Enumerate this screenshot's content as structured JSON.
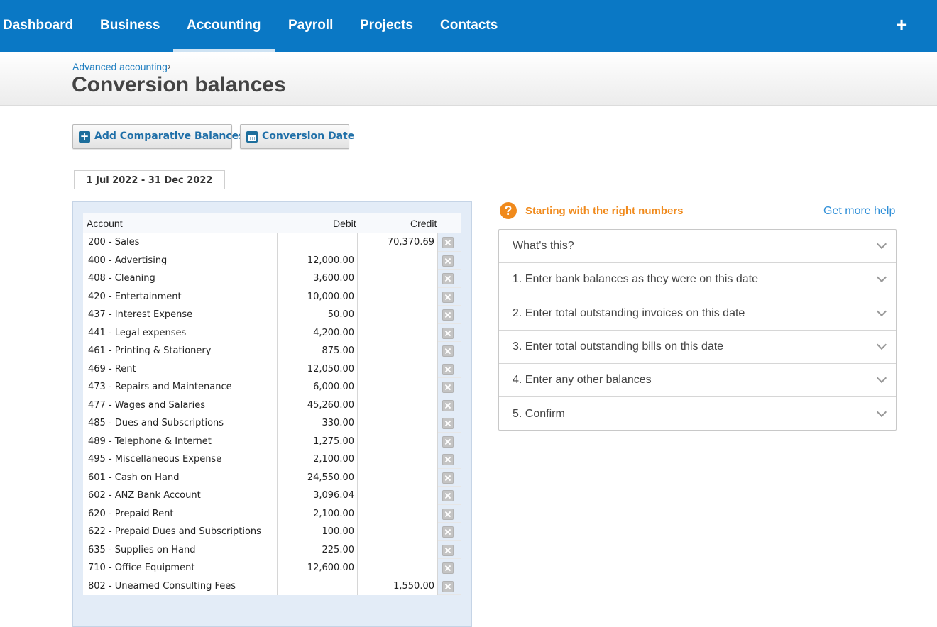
{
  "nav": {
    "items": [
      {
        "label": "Dashboard",
        "active": false
      },
      {
        "label": "Business",
        "active": false
      },
      {
        "label": "Accounting",
        "active": true
      },
      {
        "label": "Payroll",
        "active": false
      },
      {
        "label": "Projects",
        "active": false
      },
      {
        "label": "Contacts",
        "active": false
      }
    ],
    "plus_label": "+"
  },
  "header": {
    "breadcrumb": "Advanced accounting",
    "breadcrumb_separator": "›",
    "title": "Conversion balances"
  },
  "toolbar": {
    "add_comparative_label": "Add Comparative Balances",
    "conversion_date_label": "Conversion Date"
  },
  "period_tab": "1 Jul 2022 - 31 Dec 2022",
  "table": {
    "headers": {
      "account": "Account",
      "debit": "Debit",
      "credit": "Credit"
    },
    "rows": [
      {
        "account": "200 - Sales",
        "debit": "",
        "credit": "70,370.69"
      },
      {
        "account": "400 - Advertising",
        "debit": "12,000.00",
        "credit": ""
      },
      {
        "account": "408 - Cleaning",
        "debit": "3,600.00",
        "credit": ""
      },
      {
        "account": "420 - Entertainment",
        "debit": "10,000.00",
        "credit": ""
      },
      {
        "account": "437 - Interest Expense",
        "debit": "50.00",
        "credit": ""
      },
      {
        "account": "441 - Legal expenses",
        "debit": "4,200.00",
        "credit": ""
      },
      {
        "account": "461 - Printing & Stationery",
        "debit": "875.00",
        "credit": ""
      },
      {
        "account": "469 - Rent",
        "debit": "12,050.00",
        "credit": ""
      },
      {
        "account": "473 - Repairs and Maintenance",
        "debit": "6,000.00",
        "credit": ""
      },
      {
        "account": "477 - Wages and Salaries",
        "debit": "45,260.00",
        "credit": ""
      },
      {
        "account": "485 - Dues and Subscriptions",
        "debit": "330.00",
        "credit": ""
      },
      {
        "account": "489 - Telephone & Internet",
        "debit": "1,275.00",
        "credit": ""
      },
      {
        "account": "495 - Miscellaneous Expense",
        "debit": "2,100.00",
        "credit": ""
      },
      {
        "account": "601 - Cash on Hand",
        "debit": "24,550.00",
        "credit": ""
      },
      {
        "account": "602 - ANZ Bank Account",
        "debit": "3,096.04",
        "credit": ""
      },
      {
        "account": "620 - Prepaid Rent",
        "debit": "2,100.00",
        "credit": ""
      },
      {
        "account": "622 - Prepaid Dues and Subscriptions",
        "debit": "100.00",
        "credit": ""
      },
      {
        "account": "635 - Supplies on Hand",
        "debit": "225.00",
        "credit": ""
      },
      {
        "account": "710 - Office Equipment",
        "debit": "12,600.00",
        "credit": ""
      },
      {
        "account": "802 - Unearned Consulting Fees",
        "debit": "",
        "credit": "1,550.00"
      }
    ]
  },
  "help": {
    "icon_glyph": "?",
    "title": "Starting with the right numbers",
    "more_link": "Get more help",
    "accent_color": "#f08a1c",
    "sections": [
      "What's this?",
      "1. Enter bank balances as they were on this date",
      "2. Enter total outstanding invoices on this date",
      "3. Enter total outstanding bills on this date",
      "4. Enter any other balances",
      "5. Confirm"
    ]
  },
  "colors": {
    "nav_bg": "#0a78c5",
    "link": "#1f7ec0",
    "panel_bg": "#e3ecf7"
  }
}
